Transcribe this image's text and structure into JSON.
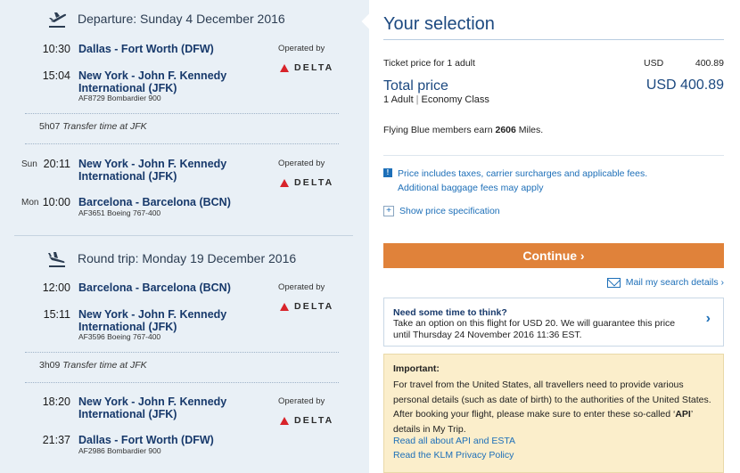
{
  "departure": {
    "title": "Departure: Sunday 4 December 2016",
    "segments": [
      {
        "day": "",
        "dep_time": "10:30",
        "dep_place": "Dallas - Fort Worth (DFW)",
        "arr_time": "15:04",
        "arr_place": "New York - John F. Kennedy International (JFK)",
        "flight": "AF8729 Bombardier 900",
        "operated_by": "Operated by",
        "airline": "DELTA"
      },
      {
        "dep_day": "Sun",
        "dep_time": "20:11",
        "dep_place": "New York - John F. Kennedy International (JFK)",
        "arr_day": "Mon",
        "arr_time": "10:00",
        "arr_place": "Barcelona - Barcelona (BCN)",
        "flight": "AF3651 Boeing 767-400",
        "operated_by": "Operated by",
        "airline": "DELTA"
      }
    ],
    "transfer_duration": "5h07",
    "transfer_text": "Transfer time at JFK"
  },
  "return": {
    "title": "Round trip: Monday 19 December 2016",
    "segments": [
      {
        "dep_time": "12:00",
        "dep_place": "Barcelona - Barcelona (BCN)",
        "arr_time": "15:11",
        "arr_place": "New York - John F. Kennedy International (JFK)",
        "flight": "AF3596 Boeing 767-400",
        "operated_by": "Operated by",
        "airline": "DELTA"
      },
      {
        "dep_time": "18:20",
        "dep_place": "New York - John F. Kennedy International (JFK)",
        "arr_time": "21:37",
        "arr_place": "Dallas - Fort Worth (DFW)",
        "flight": "AF2986 Bombardier 900",
        "operated_by": "Operated by",
        "airline": "DELTA"
      }
    ],
    "transfer_duration": "3h09",
    "transfer_text": "Transfer time at JFK"
  },
  "selection": {
    "title": "Your selection",
    "ticket_label": "Ticket price for 1 adult",
    "ticket_currency": "USD",
    "ticket_value": "400.89",
    "total_label": "Total price",
    "total_value": "USD 400.89",
    "passengers": "1 Adult",
    "cabin": "Economy Class",
    "miles_prefix": "Flying Blue members earn",
    "miles_value": "2606",
    "miles_suffix": "Miles.",
    "info_line1": "Price includes taxes, carrier surcharges and applicable fees.",
    "info_line2": "Additional baggage fees may apply",
    "spec_link": "Show price specification",
    "continue_label": "Continue ›",
    "mail_link": "Mail my search details ›"
  },
  "think": {
    "heading": "Need some time to think?",
    "text": "Take an option on this flight for USD 20. We will guarantee this price until Thursday 24 November 2016 11:36 EST."
  },
  "important": {
    "heading": "Important:",
    "text_before": "For travel from the United States, all travellers need to provide various personal details (such as date of birth) to the authorities of the United States. After booking your flight, please make sure to enter these so-called ‘",
    "text_bold": "API",
    "text_after": "’ details in My Trip.",
    "link1": "Read all about API and ESTA",
    "link2": "Read the KLM Privacy Policy"
  },
  "colors": {
    "left_bg": "#e9f0f6",
    "brand_blue": "#1c4980",
    "link_blue": "#1d6fb8",
    "continue_orange": "#e0823a",
    "important_bg": "#fbeecb",
    "delta_red": "#d8232a"
  }
}
